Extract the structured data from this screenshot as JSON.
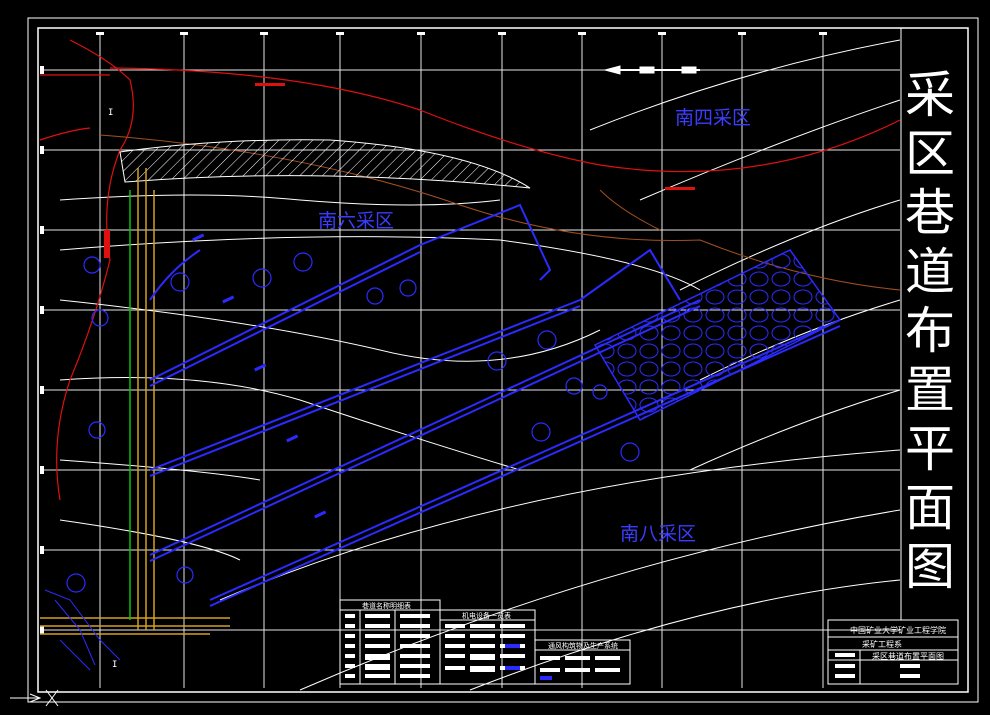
{
  "title_chars": [
    "采",
    "区",
    "巷",
    "道",
    "布",
    "置",
    "平",
    "面",
    "图"
  ],
  "area_labels": {
    "south_four": "南四采区",
    "south_six": "南六采区",
    "south_eight": "南八采区"
  },
  "tables": {
    "roadway_names": "巷道名称明细表",
    "equipment": "机电设备一览表",
    "ventilation": "通风构筑物及生产系统"
  },
  "title_block": {
    "school": "中国矿业大学矿业工程学院",
    "project": "采矿工程系",
    "drawing_name": "采区巷道布置平面图"
  },
  "section_markers": {
    "top": "I",
    "bottom": "I"
  },
  "colors": {
    "background": "#000000",
    "grid": "#ffffff",
    "roadway": "#2b2bff",
    "boundary": "#e01010",
    "main_shaft": "#d4a020",
    "ventilation": "#10c010",
    "area_label": "#3a3dff"
  }
}
